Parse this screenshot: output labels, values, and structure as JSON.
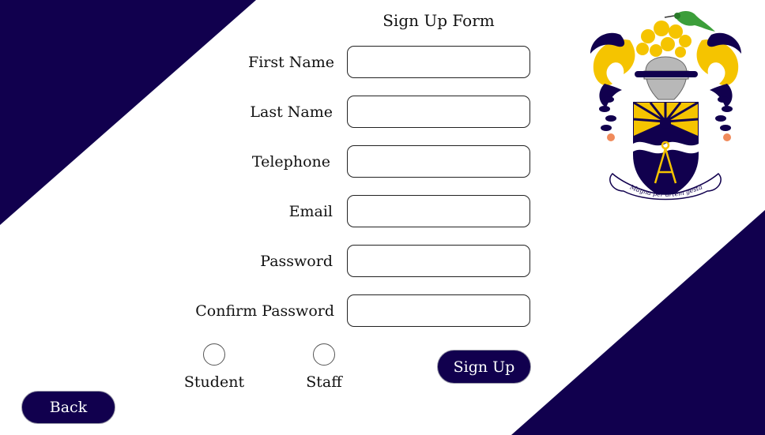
{
  "colors": {
    "navy": "#11004e",
    "gold": "#f5c400",
    "white": "#ffffff"
  },
  "form": {
    "title": "Sign Up Form",
    "fields": [
      {
        "label": "First Name",
        "value": ""
      },
      {
        "label": "Last Name",
        "value": ""
      },
      {
        "label": "Telephone",
        "value": ""
      },
      {
        "label": "Email",
        "value": ""
      },
      {
        "label": "Password",
        "value": ""
      },
      {
        "label": "Confirm Password",
        "value": ""
      }
    ],
    "roles": [
      {
        "label": "Student",
        "selected": false
      },
      {
        "label": "Staff",
        "selected": false
      }
    ],
    "signup_label": "Sign Up"
  },
  "back_label": "Back",
  "crest": {
    "motto": "Magna per artem gesta"
  }
}
